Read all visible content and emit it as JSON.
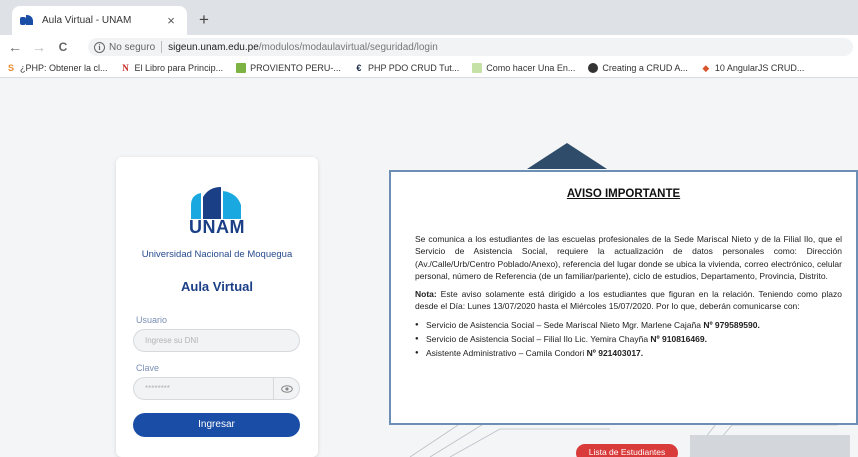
{
  "browser": {
    "tab_title": "Aula Virtual - UNAM",
    "tab_close": "×",
    "new_tab": "+",
    "nav": {
      "back": "←",
      "forward": "→",
      "reload": "C"
    },
    "omnibox": {
      "security_label": "No seguro",
      "host": "sigeun.unam.edu.pe",
      "path": "/modulos/modaulavirtual/seguridad/login"
    },
    "bookmarks": [
      {
        "label": "¿PHP: Obtener la cl...",
        "icon": "php-icon"
      },
      {
        "label": "El Libro para Princip...",
        "icon": "n-icon"
      },
      {
        "label": "PROVIENTO PERU-...",
        "icon": "proviento-icon"
      },
      {
        "label": "PHP PDO CRUD Tut...",
        "icon": "cc-icon"
      },
      {
        "label": "Como hacer Una En...",
        "icon": "doc-icon"
      },
      {
        "label": "Creating a CRUD A...",
        "icon": "circle-icon"
      },
      {
        "label": "10 AngularJS CRUD...",
        "icon": "angular-icon"
      }
    ]
  },
  "login": {
    "logo_text": "UNAM",
    "university": "Universidad Nacional de Moquegua",
    "heading": "Aula Virtual",
    "user_label": "Usuario",
    "user_placeholder": "Ingrese su DNI",
    "password_label": "Clave",
    "password_value": "********",
    "submit_label": "Ingresar",
    "colors": {
      "brand": "#1b3f86",
      "button": "#1a4ea6",
      "logo_accent": "#1aa8e0"
    }
  },
  "notice": {
    "title": "AVISO IMPORTANTE",
    "paragraph1": "Se comunica a los estudiantes de las escuelas profesionales de la Sede Mariscal Nieto y de la Filial Ilo, que el Servicio de Asistencia Social, requiere la actualización de datos personales como: Dirección (Av./Calle/Urb/Centro Poblado/Anexo), referencia del lugar donde se ubica la vivienda, correo electrónico, celular personal, número de Referencia (de un familiar/pariente), ciclo de estudios, Departamento, Provincia, Distrito.",
    "note_label": "Nota:",
    "note_text": " Este aviso solamente está dirigido a los estudiantes que figuran en la relación. Teniendo como plazo desde el Día: Lunes 13/07/2020 hasta el Miércoles 15/07/2020. Por lo que, deberán comunicarse con:",
    "contacts": [
      {
        "text": "Servicio de Asistencia Social – Sede Mariscal Nieto Mgr. Marlene Cajaña ",
        "phone": "Nº 979589590."
      },
      {
        "text": "Servicio de Asistencia Social – Filial Ilo Lic. Yemira Chayña ",
        "phone": "Nº 910816469."
      },
      {
        "text": "Asistente Administrativo – Camila Condori ",
        "phone": "Nº 921403017."
      }
    ],
    "border_color": "#6d8fb5"
  },
  "students_button": "Lista de Estudiantes"
}
